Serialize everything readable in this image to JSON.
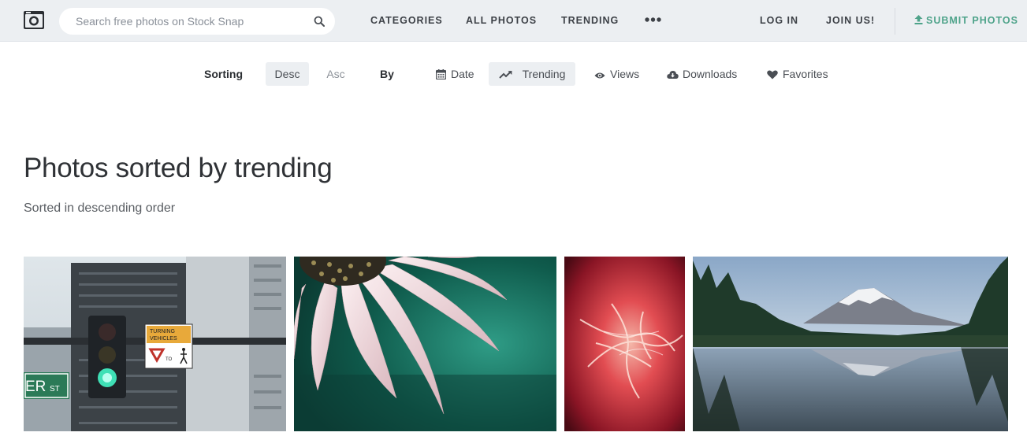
{
  "header": {
    "search_placeholder": "Search free photos on Stock Snap",
    "nav": {
      "categories": "CATEGORIES",
      "all_photos": "ALL PHOTOS",
      "trending": "TRENDING"
    },
    "login": "LOG IN",
    "join": "JOIN US!",
    "submit": "SUBMIT PHOTOS"
  },
  "sort_bar": {
    "sorting_label": "Sorting",
    "order_options": [
      {
        "label": "Desc",
        "active": true
      },
      {
        "label": "Asc",
        "active": false
      }
    ],
    "by_label": "By",
    "by_options": [
      {
        "label": "Date",
        "icon": "calendar-icon",
        "active": false
      },
      {
        "label": "Trending",
        "icon": "trending-icon",
        "active": true
      },
      {
        "label": "Views",
        "icon": "eye-icon",
        "active": false
      },
      {
        "label": "Downloads",
        "icon": "cloud-download-icon",
        "active": false
      },
      {
        "label": "Favorites",
        "icon": "heart-icon",
        "active": false
      }
    ]
  },
  "main": {
    "title": "Photos sorted by trending",
    "subtitle": "Sorted in descending order"
  },
  "photos": [
    {
      "subject": "traffic-light-street"
    },
    {
      "subject": "pink-flower-petals"
    },
    {
      "subject": "red-abstract-swirl"
    },
    {
      "subject": "mountain-lake-reflection"
    }
  ],
  "colors": {
    "header_bg": "#eceff2",
    "accent": "#4ea38a",
    "text_dark": "#2f3236"
  },
  "street_sign": {
    "line1": "TURNING",
    "line2": "VEHICLES",
    "to": "TO",
    "street_short": "ER",
    "street_suffix": "ST"
  }
}
